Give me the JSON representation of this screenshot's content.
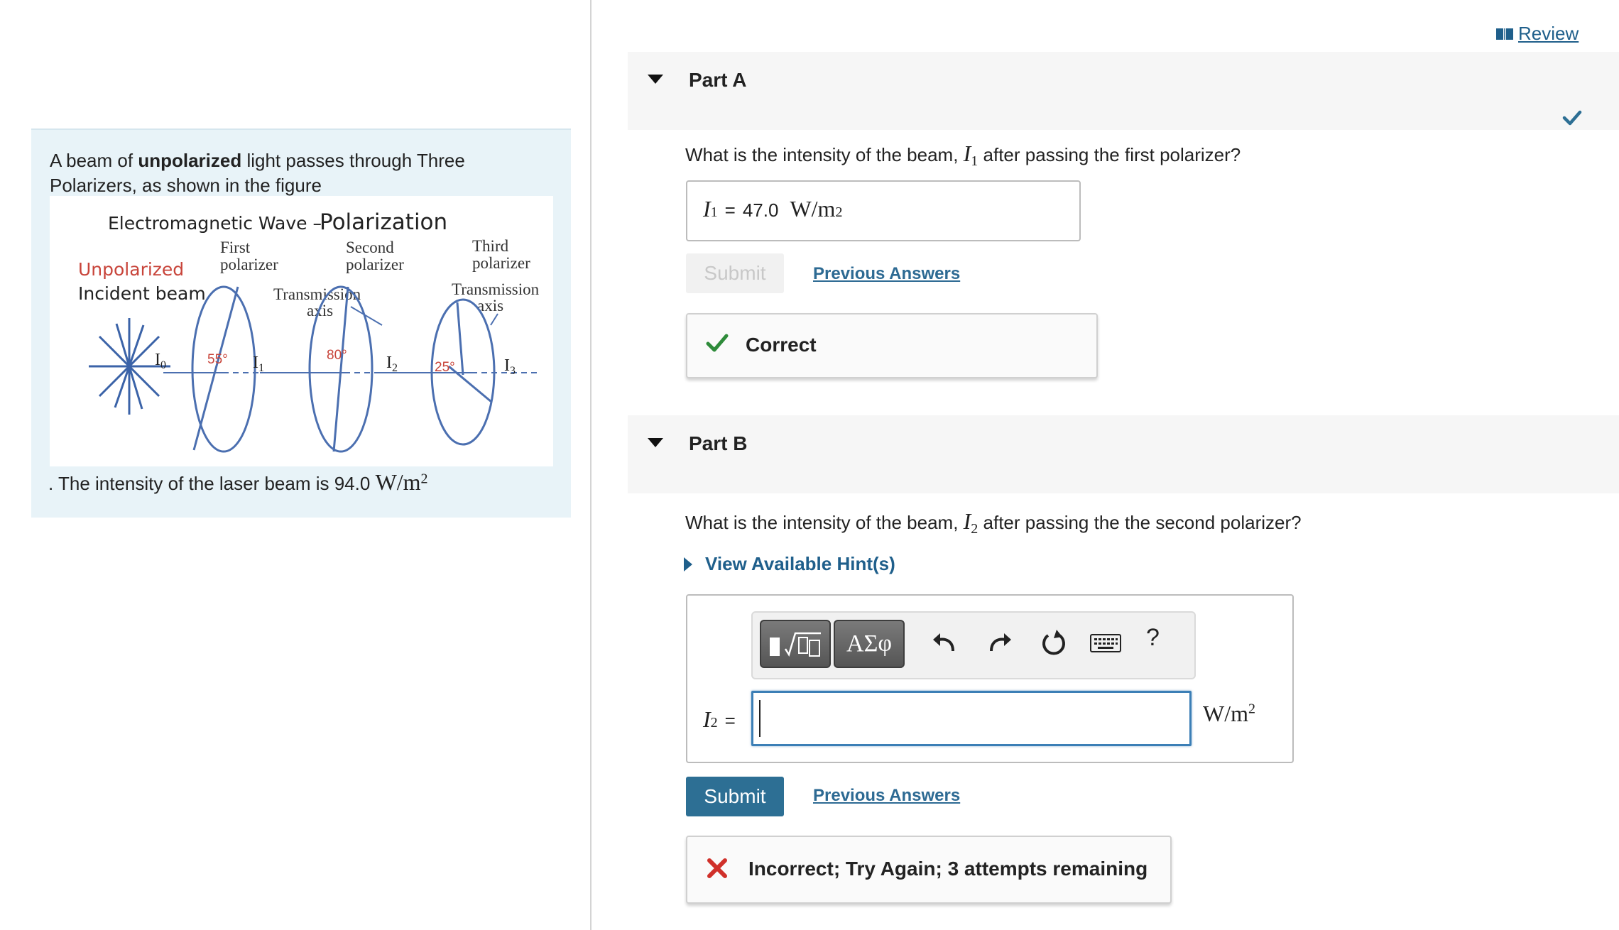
{
  "intro": {
    "text_before": "A beam of ",
    "text_bold": "unpolarized",
    "text_after": " light passes through Three Polarizers, as shown in the figure",
    "intensity_prefix": ". The intensity of the laser beam is 94.0 ",
    "intensity_unit": "W/m",
    "intensity_exp": "2"
  },
  "figure": {
    "title_main": "Electromagnetic Wave – ",
    "title_big": "Polarization",
    "unpolarized": "Unpolarized",
    "incident_beam": "Incident beam",
    "first": "First",
    "second": "Second",
    "third": "Third",
    "polarizer": "polarizer",
    "transmission": "Transmission",
    "axis": "axis",
    "I0": "I",
    "I0_sub": "0",
    "I1_sub": "1",
    "I2_sub": "2",
    "I3_sub": "3",
    "angle1": "55°",
    "angle2": "80°",
    "angle3": "25°"
  },
  "review": {
    "label": "Review"
  },
  "partA": {
    "title": "Part A",
    "question_before": "What is the intensity of the beam, ",
    "question_var": "I",
    "question_sub": "1",
    "question_after": " after passing the first polarizer?",
    "answer_var": "I",
    "answer_sub": "1",
    "answer_eq": "=",
    "answer_value": "47.0",
    "answer_unit": "W/m",
    "answer_exp": "2",
    "submit_label": "Submit",
    "previous_label": "Previous Answers",
    "feedback": "Correct"
  },
  "partB": {
    "title": "Part B",
    "question_before": "What is the intensity of the beam, ",
    "question_var": "I",
    "question_sub": "2",
    "question_after": " after passing the the second polarizer?",
    "hint_label": "View Available Hint(s)",
    "toolbar_greek": "ΑΣφ",
    "toolbar_help": "?",
    "label_var": "I",
    "label_sub": "2",
    "label_eq": "=",
    "input_value": "",
    "unit": "W/m",
    "unit_exp": "2",
    "submit_label": "Submit",
    "previous_label": "Previous Answers",
    "feedback": "Incorrect; Try Again; 3 attempts remaining"
  },
  "colors": {
    "accent": "#2d6f94",
    "link": "#1f5f8b",
    "correct": "#2e8b3a",
    "incorrect": "#d0302a",
    "intro_bg": "#e8f3f8"
  }
}
